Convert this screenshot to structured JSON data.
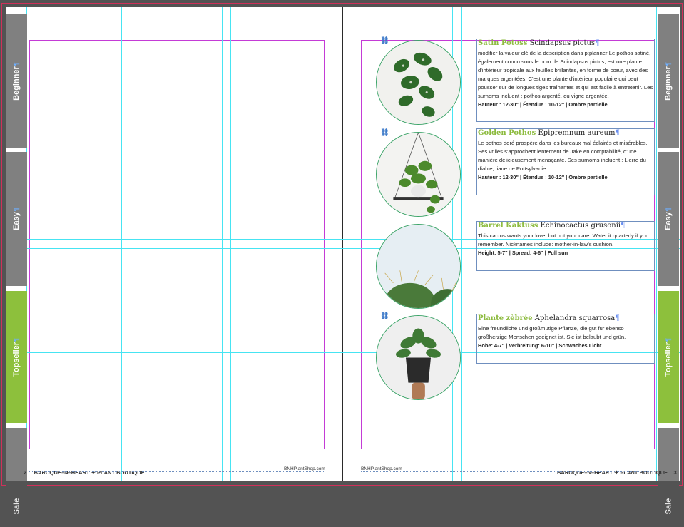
{
  "spread": {
    "left_page": {
      "page_number": "2",
      "footer_brand": "BAROQUE–N–HEART ✦ PLANT BOUTIQUE",
      "footer_url": "BNHPlantShop.com"
    },
    "right_page": {
      "page_number": "3",
      "footer_brand": "BAROQUE–N–HEART ✦ PLANT BOUTIQUE",
      "footer_url": "BNHPlantShop.com"
    }
  },
  "side_tabs": {
    "left": [
      {
        "label": "Beginner",
        "state": "grey"
      },
      {
        "label": "Easy",
        "state": "grey"
      },
      {
        "label": "Topseller",
        "state": "green"
      },
      {
        "label": "Sale",
        "state": "dark"
      }
    ],
    "right": [
      {
        "label": "Beginner",
        "state": "grey"
      },
      {
        "label": "Easy",
        "state": "grey"
      },
      {
        "label": "Topseller",
        "state": "green"
      },
      {
        "label": "Sale",
        "state": "dark"
      }
    ]
  },
  "plants": [
    {
      "common": "Satin Potoss",
      "scientific": "Scindapsus pictus",
      "description": "modifier la valeur clé de la description dans p:planner Le pothos satiné, également connu sous le nom de Scindapsus pictus, est une plante d'intérieur tropicale aux feuilles brillantes, en forme de cœur, avec des marques argentées. C'est une plante d'intérieur populaire qui peut pousser sur de longues tiges traînantes et qui est facile à entretenir. Les surnoms incluent : pothos argenté, ou vigne argentée.",
      "specs": "Hauteur : 12-30\" | Étendue : 10-12\" | Ombre partielle"
    },
    {
      "common": "Golden Pothos",
      "scientific": "Epipremnum aureum",
      "description": "Le pothos doré prospère dans les bureaux mal éclairés et misérables. Ses vrilles s'approchent lentement de Jake en comptabilité, d'une manière délicieusement menaçante. Ses surnoms incluent : Lierre du diable, liane de Pottsylvanie",
      "specs": "Hauteur : 12-30\" | Étendue : 10-12\" | Ombre partielle"
    },
    {
      "common": "Barrel Kaktuss",
      "scientific": "Echinocactus grusonii",
      "description": "This cactus wants your love, but not your care. Water it quarterly if you remember. Nicknames include: mother-in-law's cushion.",
      "specs": "Height: 5-7\" | Spread: 4-6\" | Full sun"
    },
    {
      "common": "Plante zèbrée",
      "scientific": "Aphelandra squarrosa",
      "description": "Eine freundliche und großmütige Pflanze, die gut für ebenso großherzige Menschen geeignet ist. Sie ist belaubt und grün.",
      "specs": "Höhe: 4-7\" | Verbreitung: 6-10\" | Schwaches Licht"
    }
  ],
  "icons": {
    "link": "chain-link-icon",
    "pilcrow": "¶",
    "anchor": "anchor-marker-icon"
  },
  "colors": {
    "pasteboard": "#535353",
    "page": "#ffffff",
    "guide": "#46e4f2",
    "margin": "#c43bd6",
    "bleed": "#d0305a",
    "tab_grey": "#808080",
    "tab_green": "#8dc03c",
    "accent_title": "#8dbb3f",
    "frame_circle": "#3ea56a"
  }
}
